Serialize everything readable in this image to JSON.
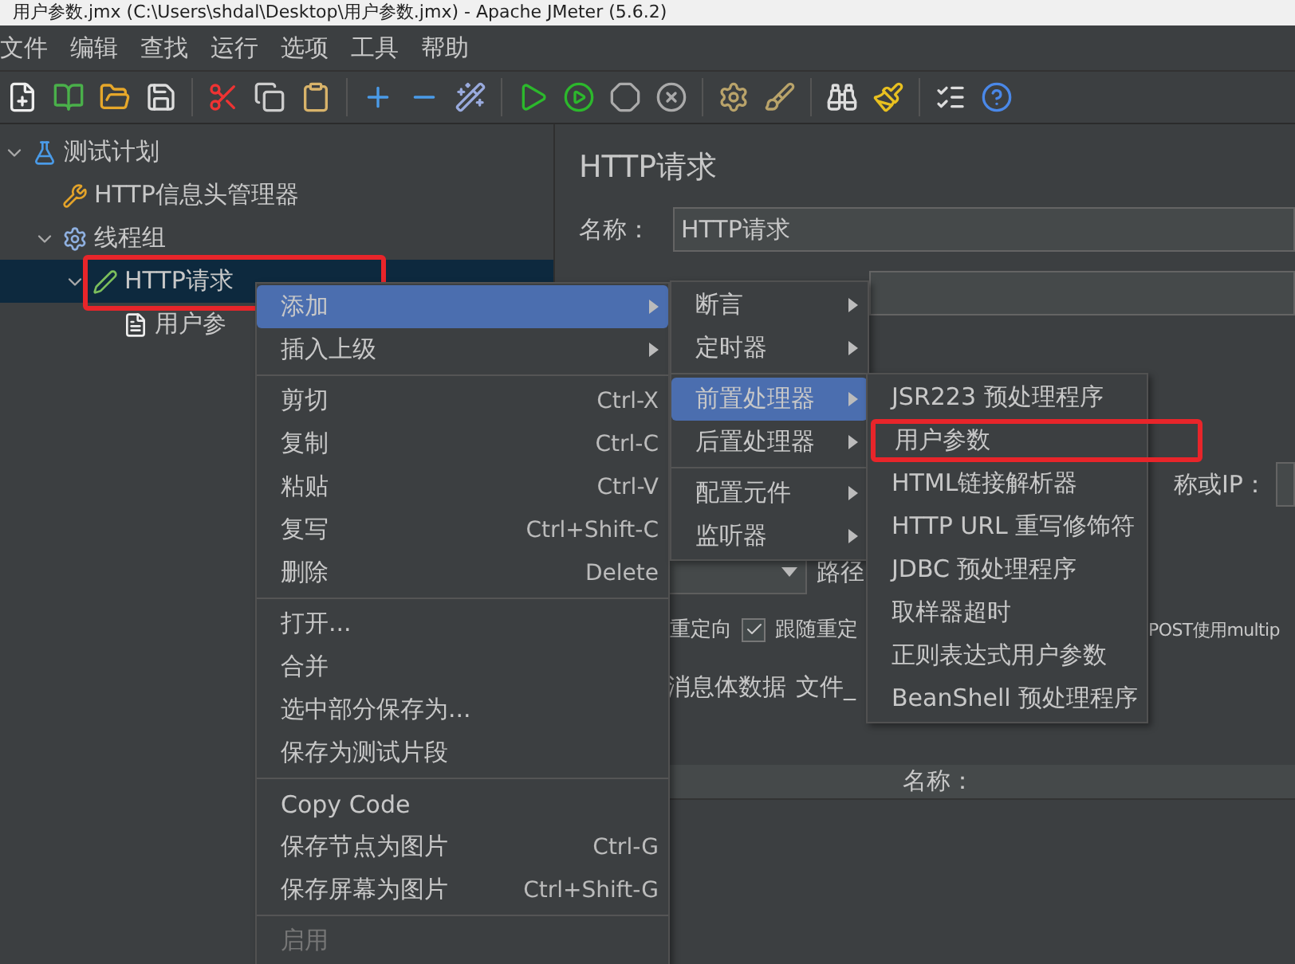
{
  "window": {
    "title": "用户参数.jmx (C:\\Users\\shdal\\Desktop\\用户参数.jmx) - Apache JMeter (5.6.2)"
  },
  "menu_bar": [
    "文件",
    "编辑",
    "查找",
    "运行",
    "选项",
    "工具",
    "帮助"
  ],
  "tree": [
    {
      "label": "测试计划",
      "kind": "plan",
      "expanded": true,
      "selected": false,
      "children": [
        {
          "label": "HTTP信息头管理器",
          "kind": "config",
          "selected": false
        },
        {
          "label": "线程组",
          "kind": "threads",
          "expanded": true,
          "selected": false,
          "children": [
            {
              "label": "HTTP请求",
              "kind": "sampler",
              "expanded": true,
              "selected": true,
              "children": [
                {
                  "label": "用户参",
                  "kind": "preprocessor",
                  "selected": false
                }
              ]
            }
          ]
        }
      ]
    }
  ],
  "editor": {
    "title": "HTTP请求",
    "name_label": "名称：",
    "name_value": "HTTP请求",
    "server_label": "称或IP：",
    "path_label": "路径",
    "options": [
      {
        "label": "重定向"
      },
      {
        "label": "跟随重定",
        "checked": true
      },
      {
        "label": "POST使用multip"
      }
    ],
    "tabs": [
      {
        "label": "消息体数据",
        "selected": false
      },
      {
        "label": "文件_",
        "selected": false
      }
    ],
    "table_column": "名称："
  },
  "context_menu": [
    {
      "kind": "submenu",
      "label": "添加",
      "selected": true,
      "disabled": false
    },
    {
      "kind": "submenu",
      "label": "插入上级",
      "selected": false,
      "disabled": false
    },
    {
      "kind": "separator"
    },
    {
      "kind": "item",
      "label": "剪切",
      "shortcut": "Ctrl-X",
      "selected": false,
      "disabled": false
    },
    {
      "kind": "item",
      "label": "复制",
      "shortcut": "Ctrl-C",
      "selected": false,
      "disabled": false
    },
    {
      "kind": "item",
      "label": "粘贴",
      "shortcut": "Ctrl-V",
      "selected": false,
      "disabled": false
    },
    {
      "kind": "item",
      "label": "复写",
      "shortcut": "Ctrl+Shift-C",
      "selected": false,
      "disabled": false
    },
    {
      "kind": "item",
      "label": "删除",
      "shortcut": "Delete",
      "selected": false,
      "disabled": false
    },
    {
      "kind": "separator"
    },
    {
      "kind": "item",
      "label": "打开...",
      "selected": false,
      "disabled": false
    },
    {
      "kind": "item",
      "label": "合并",
      "selected": false,
      "disabled": false
    },
    {
      "kind": "item",
      "label": "选中部分保存为...",
      "selected": false,
      "disabled": false
    },
    {
      "kind": "item",
      "label": "保存为测试片段",
      "selected": false,
      "disabled": false
    },
    {
      "kind": "separator"
    },
    {
      "kind": "item",
      "label": "Copy Code",
      "selected": false,
      "disabled": false
    },
    {
      "kind": "item",
      "label": "保存节点为图片",
      "shortcut": "Ctrl-G",
      "selected": false,
      "disabled": false
    },
    {
      "kind": "item",
      "label": "保存屏幕为图片",
      "shortcut": "Ctrl+Shift-G",
      "selected": false,
      "disabled": false
    },
    {
      "kind": "separator"
    },
    {
      "kind": "item",
      "label": "启用",
      "selected": false,
      "disabled": true
    }
  ],
  "add_menu": [
    {
      "kind": "submenu",
      "label": "断言",
      "selected": false
    },
    {
      "kind": "submenu",
      "label": "定时器",
      "selected": false
    },
    {
      "kind": "separator"
    },
    {
      "kind": "submenu",
      "label": "前置处理器",
      "selected": true
    },
    {
      "kind": "submenu",
      "label": "后置处理器",
      "selected": false
    },
    {
      "kind": "separator"
    },
    {
      "kind": "submenu",
      "label": "配置元件",
      "selected": false
    },
    {
      "kind": "submenu",
      "label": "监听器",
      "selected": false
    }
  ],
  "preprocessor_menu": [
    {
      "kind": "item",
      "label": "JSR223 预处理程序",
      "selected": false,
      "highlighted": false
    },
    {
      "kind": "item",
      "label": "用户参数",
      "selected": false,
      "highlighted": true
    },
    {
      "kind": "item",
      "label": "HTML链接解析器",
      "selected": false,
      "highlighted": false
    },
    {
      "kind": "item",
      "label": "HTTP URL 重写修饰符",
      "selected": false,
      "highlighted": false
    },
    {
      "kind": "item",
      "label": "JDBC 预处理程序",
      "selected": false,
      "highlighted": false
    },
    {
      "kind": "item",
      "label": "取样器超时",
      "selected": false,
      "highlighted": false
    },
    {
      "kind": "item",
      "label": "正则表达式用户参数",
      "selected": false,
      "highlighted": false
    },
    {
      "kind": "item",
      "label": "BeanShell 预处理程序",
      "selected": false,
      "highlighted": false
    }
  ]
}
